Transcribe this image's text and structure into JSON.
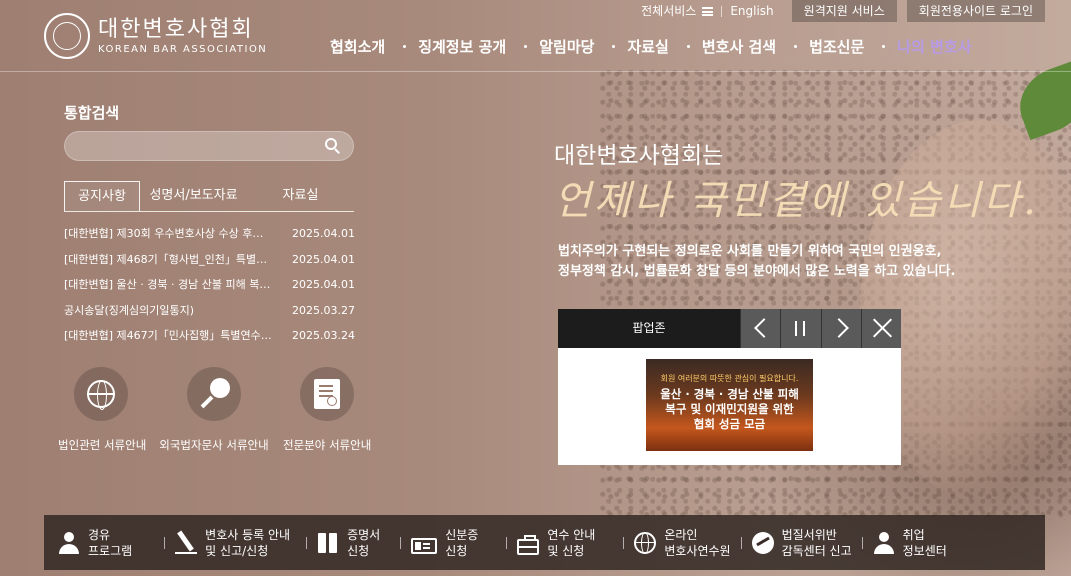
{
  "header": {
    "util": {
      "all_services": "전체서비스",
      "english": "English",
      "remote_support": "원격지원 서비스",
      "member_login": "회원전용사이트 로그인"
    },
    "logo": {
      "ko": "대한변호사협회",
      "en": "KOREAN BAR ASSOCIATION"
    },
    "gnb": [
      {
        "label": "협회소개"
      },
      {
        "label": "징계정보 공개"
      },
      {
        "label": "알림마당"
      },
      {
        "label": "자료실"
      },
      {
        "label": "변호사 검색"
      },
      {
        "label": "법조신문"
      },
      {
        "label": "나의 변호사"
      }
    ]
  },
  "search": {
    "title": "통합검색",
    "placeholder": ""
  },
  "tabs": [
    {
      "label": "공지사항"
    },
    {
      "label": "성명서/보도자료"
    },
    {
      "label": "자료실"
    }
  ],
  "notices": [
    {
      "title": "[대한변협] 제30회 우수변호사상 수상 후…",
      "date": "2025.04.01"
    },
    {
      "title": "[대한변협] 제468기「형사법_인천」특별연…",
      "date": "2025.04.01"
    },
    {
      "title": "[대한변협] 울산 · 경북 · 경남 산불 피해 복…",
      "date": "2025.04.01"
    },
    {
      "title": "공시송달(징계심의기일통지)",
      "date": "2025.03.27"
    },
    {
      "title": "[대한변협] 제467기「민사집행」특별연수 …",
      "date": "2025.03.24"
    }
  ],
  "quick_links": [
    {
      "label": "법인관련 서류안내",
      "icon": "globe-icon"
    },
    {
      "label": "외국법자문사 서류안내",
      "icon": "magnifier-icon"
    },
    {
      "label": "전문분야 서류안내",
      "icon": "document-icon"
    }
  ],
  "hero": {
    "line1": "대한변호사협회는",
    "line2": "언제나 국민곁에 있습니다.",
    "desc1": "법치주의가 구현되는 정의로운 사회를 만들기 위하여 국민의 인권옹호,",
    "desc2": "정부정책 감시, 법률문화 창달 등의 분야에서 많은 노력을 하고 있습니다."
  },
  "popup": {
    "title": "팝업존",
    "banner_top": "회원 여러분의 따뜻한 관심이 필요합니다.",
    "banner_line1": "울산 · 경북 · 경남 산불 피해",
    "banner_line2": "복구 및 이재민지원을 위한",
    "banner_line3": "협회 성금 모금"
  },
  "bottom_menu": [
    {
      "line1": "경유",
      "line2": "프로그램",
      "icon": "person-icon"
    },
    {
      "line1": "변호사 등록 안내",
      "line2": "및 신고/신청",
      "icon": "pen-icon"
    },
    {
      "line1": "증명서",
      "line2": "신청",
      "icon": "books-icon"
    },
    {
      "line1": "신분증",
      "line2": "신청",
      "icon": "id-card-icon"
    },
    {
      "line1": "연수 안내",
      "line2": "및 신청",
      "icon": "briefcase-icon"
    },
    {
      "line1": "온라인",
      "line2": "변호사연수원",
      "icon": "globe-icon"
    },
    {
      "line1": "법질서위반",
      "line2": "감독센터 신고",
      "icon": "ball-icon"
    },
    {
      "line1": "취업",
      "line2": "정보센터",
      "icon": "person-icon"
    }
  ],
  "colors": {
    "active_nav": "#b89be6",
    "hero_accent": "#f3dcb5",
    "popup_head": "#1c1c1c"
  }
}
